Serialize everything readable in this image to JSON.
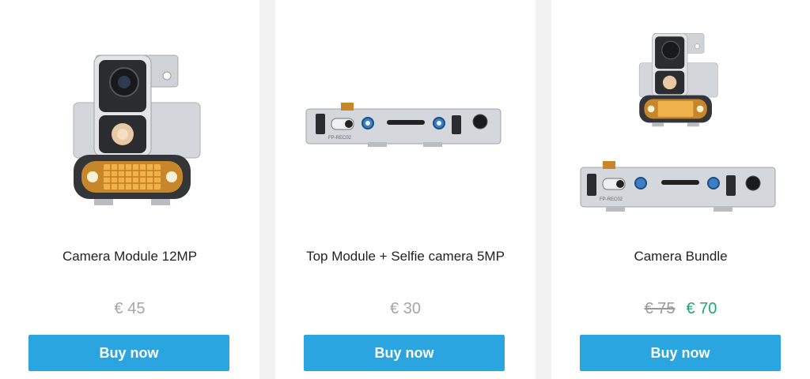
{
  "products": [
    {
      "name": "Camera Module 12MP",
      "price": "€ 45",
      "buy_label": "Buy now",
      "image_icon": "camera-module-image"
    },
    {
      "name": "Top Module + Selfie camera 5MP",
      "price": "€ 30",
      "buy_label": "Buy now",
      "image_icon": "top-module-image",
      "board_label": "FP-REC02"
    },
    {
      "name": "Camera Bundle",
      "old_price": "€ 75",
      "new_price": "€ 70",
      "buy_label": "Buy now",
      "image_icon": "camera-bundle-image",
      "board_label": "FP-REC02"
    }
  ],
  "colors": {
    "button": "#2ba5e0",
    "sale_price": "#1fa86a",
    "price": "#a6a6a6",
    "background": "#f2f2f2"
  }
}
